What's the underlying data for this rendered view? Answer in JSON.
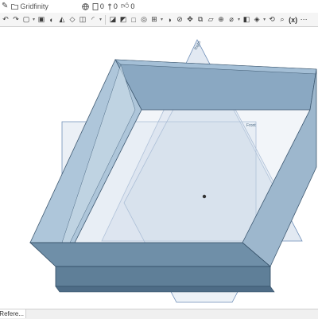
{
  "header": {
    "doc_path": "Gridfinity",
    "version_count": "0",
    "branch_count": "0",
    "like_count": "0"
  },
  "icons": {
    "edit": "pencil-icon",
    "folder": "folder-icon",
    "globe": "globe-icon",
    "document": "document-icon",
    "branch": "branch-icon",
    "like": "thumbs-up-icon"
  },
  "toolbar": {
    "variable_label": "(x)"
  },
  "viewport": {
    "plane_top_label": "Right",
    "plane_front_label": "Front"
  },
  "tabs": {
    "active_label": "gn Refere..."
  },
  "colors": {
    "wall_face": "#7f9fb8",
    "wall_light": "#aec6da",
    "plane_fill": "#a4bcd8",
    "plane_stroke": "#6f8fb8"
  }
}
